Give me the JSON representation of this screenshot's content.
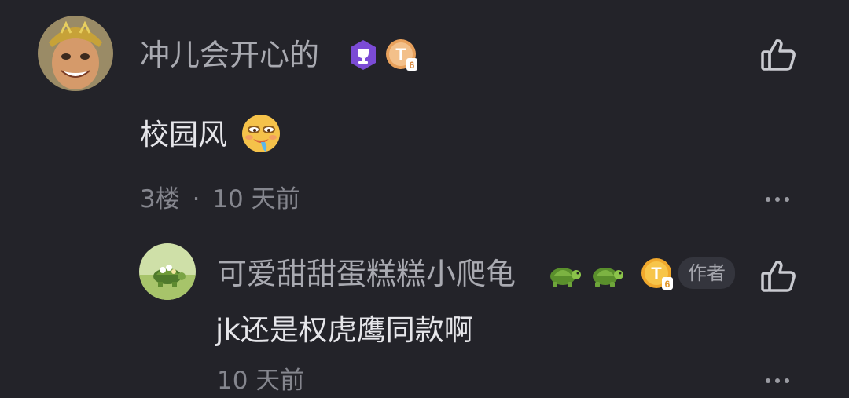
{
  "comment": {
    "username": "冲儿会开心的",
    "text": "校园风",
    "floor": "3楼",
    "separator": "·",
    "time": "10 天前",
    "level": "6"
  },
  "reply": {
    "username": "可爱甜甜蛋糕糕小爬龟",
    "text": "jk还是权虎鹰同款啊",
    "author_tag": "作者",
    "time": "10 天前",
    "level": "6"
  },
  "colors": {
    "background": "#232329",
    "username": "#a9aab1",
    "comment_text": "#e6e6ea",
    "meta": "#85868e",
    "trophy_badge": "#7b4bd6",
    "level_badge": "#f0b43c"
  }
}
